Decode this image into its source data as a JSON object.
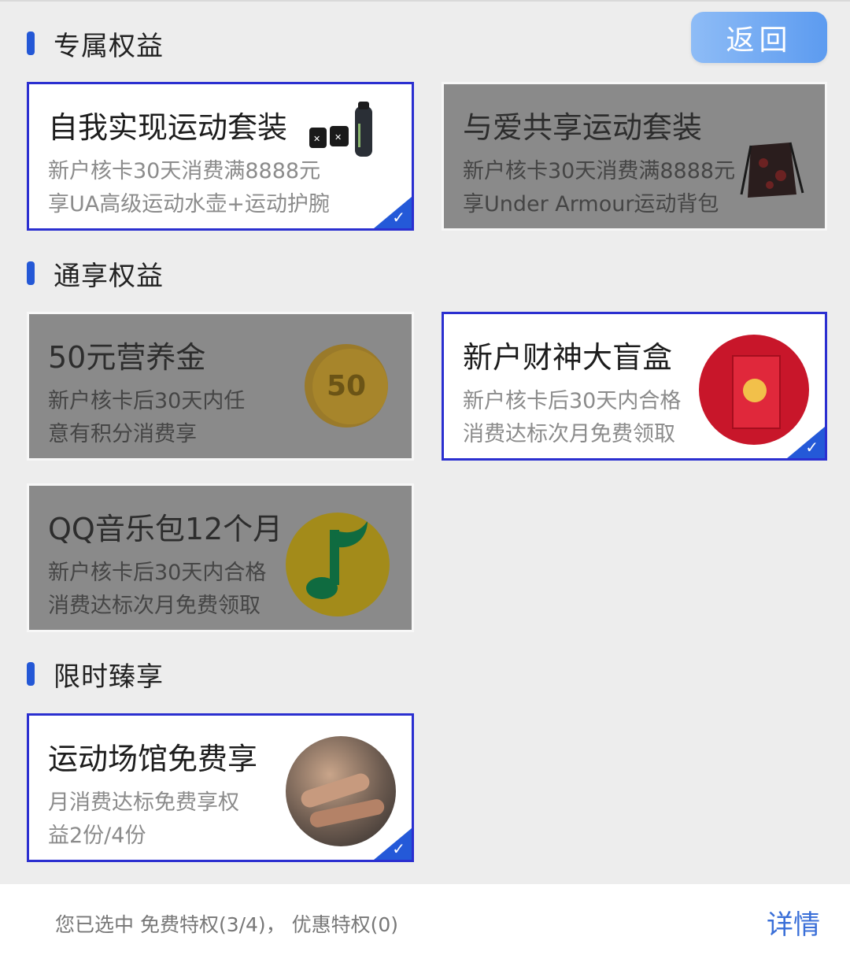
{
  "header": {
    "back_label": "返回"
  },
  "sections": [
    {
      "title": "专属权益"
    },
    {
      "title": "通享权益"
    },
    {
      "title": "限时臻享"
    }
  ],
  "cards": [
    {
      "title": "自我实现运动套装",
      "line1": "新户核卡30天消费满8888元",
      "line2": "享UA高级运动水壶+运动护腕",
      "selected": true,
      "disabled": false,
      "icon": "water-bottle-wristband-icon"
    },
    {
      "title": "与爱共享运动套装",
      "line1": "新户核卡30天消费满8888元",
      "line2": "享Under Armour运动背包",
      "selected": false,
      "disabled": true,
      "icon": "backpack-icon"
    },
    {
      "title": "50元营养金",
      "line1": "新户核卡后30天内任",
      "line2": "意有积分消费享",
      "coin_label": "50",
      "selected": false,
      "disabled": true,
      "icon": "coin-icon"
    },
    {
      "title": "新户财神大盲盒",
      "line1": "新户核卡后30天内合格",
      "line2": "消费达标次月免费领取",
      "selected": true,
      "disabled": false,
      "icon": "gift-box-icon"
    },
    {
      "title": "QQ音乐包12个月",
      "line1": "新户核卡后30天内合格",
      "line2": "消费达标次月免费领取",
      "selected": false,
      "disabled": true,
      "icon": "music-note-icon"
    },
    {
      "title": "运动场馆免费享",
      "line1": "月消费达标免费享权",
      "line2": "益2份/4份",
      "selected": true,
      "disabled": false,
      "icon": "gym-photo-icon"
    }
  ],
  "footer": {
    "summary": "您已选中 免费特权(3/4)， 优惠特权(0)",
    "detail_label": "详情"
  },
  "colors": {
    "accent": "#2459d8",
    "card_border": "#2b2fd0",
    "back_button": "#6fa6f2"
  }
}
